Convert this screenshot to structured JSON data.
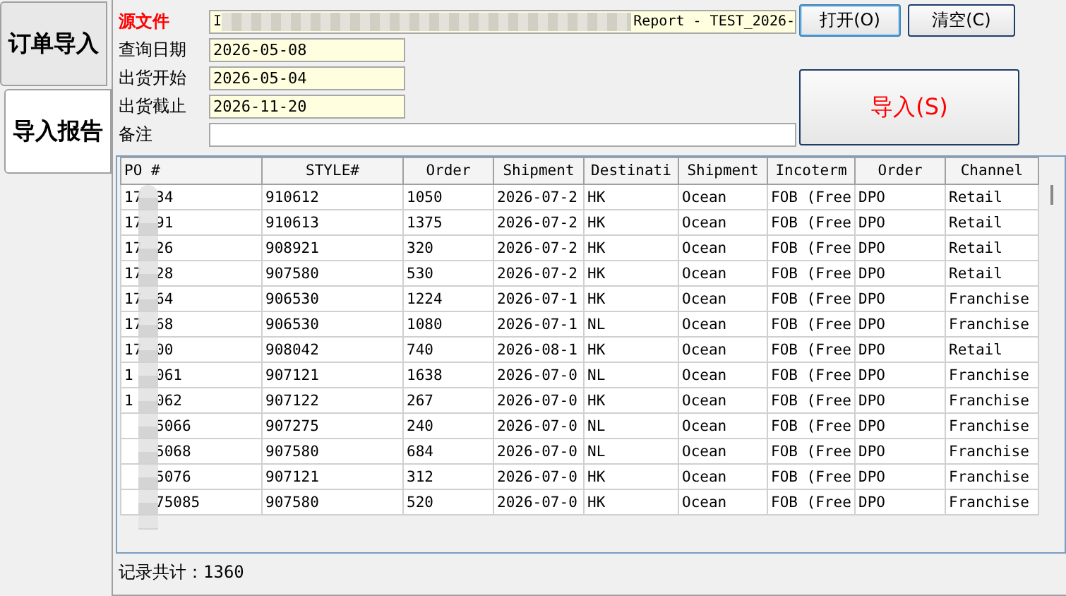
{
  "side_tabs": [
    {
      "label": "订单导入",
      "selected": false
    },
    {
      "label": "导入报告",
      "selected": true
    }
  ],
  "form": {
    "source_label": "源文件",
    "source_value_start": "I",
    "source_value_end": "Report - TEST_2026-",
    "fields": [
      {
        "label": "查询日期",
        "value": "2026-05-08"
      },
      {
        "label": "出货开始",
        "value": "2026-05-04"
      },
      {
        "label": "出货截止",
        "value": "2026-11-20"
      }
    ],
    "remarks_label": "备注"
  },
  "buttons": {
    "open": "打开(O)",
    "clear": "清空(C)",
    "import": "导入(S)"
  },
  "table": {
    "po_column": "PO #",
    "columns": [
      "STYLE#",
      "Order",
      "Shipment",
      "Destinati",
      "Shipment",
      "Incoterm",
      "Order",
      "Channel"
    ],
    "rows": [
      {
        "po_start": "17",
        "po_end": "34",
        "cells": [
          "910612",
          "1050",
          "2026-07-2",
          "HK",
          "Ocean",
          "FOB (Free",
          "DPO",
          "Retail"
        ]
      },
      {
        "po_start": "17",
        "po_end": "91",
        "cells": [
          "910613",
          "1375",
          "2026-07-2",
          "HK",
          "Ocean",
          "FOB (Free",
          "DPO",
          "Retail"
        ]
      },
      {
        "po_start": "17",
        "po_end": "26",
        "cells": [
          "908921",
          "320",
          "2026-07-2",
          "HK",
          "Ocean",
          "FOB (Free",
          "DPO",
          "Retail"
        ]
      },
      {
        "po_start": "17",
        "po_end": "28",
        "cells": [
          "907580",
          "530",
          "2026-07-2",
          "HK",
          "Ocean",
          "FOB (Free",
          "DPO",
          "Retail"
        ]
      },
      {
        "po_start": "17",
        "po_end": "64",
        "cells": [
          "906530",
          "1224",
          "2026-07-1",
          "HK",
          "Ocean",
          "FOB (Free",
          "DPO",
          "Franchise"
        ]
      },
      {
        "po_start": "17",
        "po_end": "68",
        "cells": [
          "906530",
          "1080",
          "2026-07-1",
          "NL",
          "Ocean",
          "FOB (Free",
          "DPO",
          "Franchise"
        ]
      },
      {
        "po_start": "17",
        "po_end": "00",
        "cells": [
          "908042",
          "740",
          "2026-08-1",
          "HK",
          "Ocean",
          "FOB (Free",
          "DPO",
          "Retail"
        ]
      },
      {
        "po_start": "1",
        "po_end": "061",
        "cells": [
          "907121",
          "1638",
          "2026-07-0",
          "NL",
          "Ocean",
          "FOB (Free",
          "DPO",
          "Franchise"
        ]
      },
      {
        "po_start": "1",
        "po_end": "062",
        "cells": [
          "907122",
          "267",
          "2026-07-0",
          "HK",
          "Ocean",
          "FOB (Free",
          "DPO",
          "Franchise"
        ]
      },
      {
        "po_end": "5066",
        "cells": [
          "907275",
          "240",
          "2026-07-0",
          "NL",
          "Ocean",
          "FOB (Free",
          "DPO",
          "Franchise"
        ]
      },
      {
        "po_end": "5068",
        "cells": [
          "907580",
          "684",
          "2026-07-0",
          "NL",
          "Ocean",
          "FOB (Free",
          "DPO",
          "Franchise"
        ]
      },
      {
        "po_end": "5076",
        "cells": [
          "907121",
          "312",
          "2026-07-0",
          "HK",
          "Ocean",
          "FOB (Free",
          "DPO",
          "Franchise"
        ]
      },
      {
        "po_end": "75085",
        "cells": [
          "907580",
          "520",
          "2026-07-0",
          "HK",
          "Ocean",
          "FOB (Free",
          "DPO",
          "Franchise"
        ]
      }
    ]
  },
  "status": "记录共计：1360"
}
